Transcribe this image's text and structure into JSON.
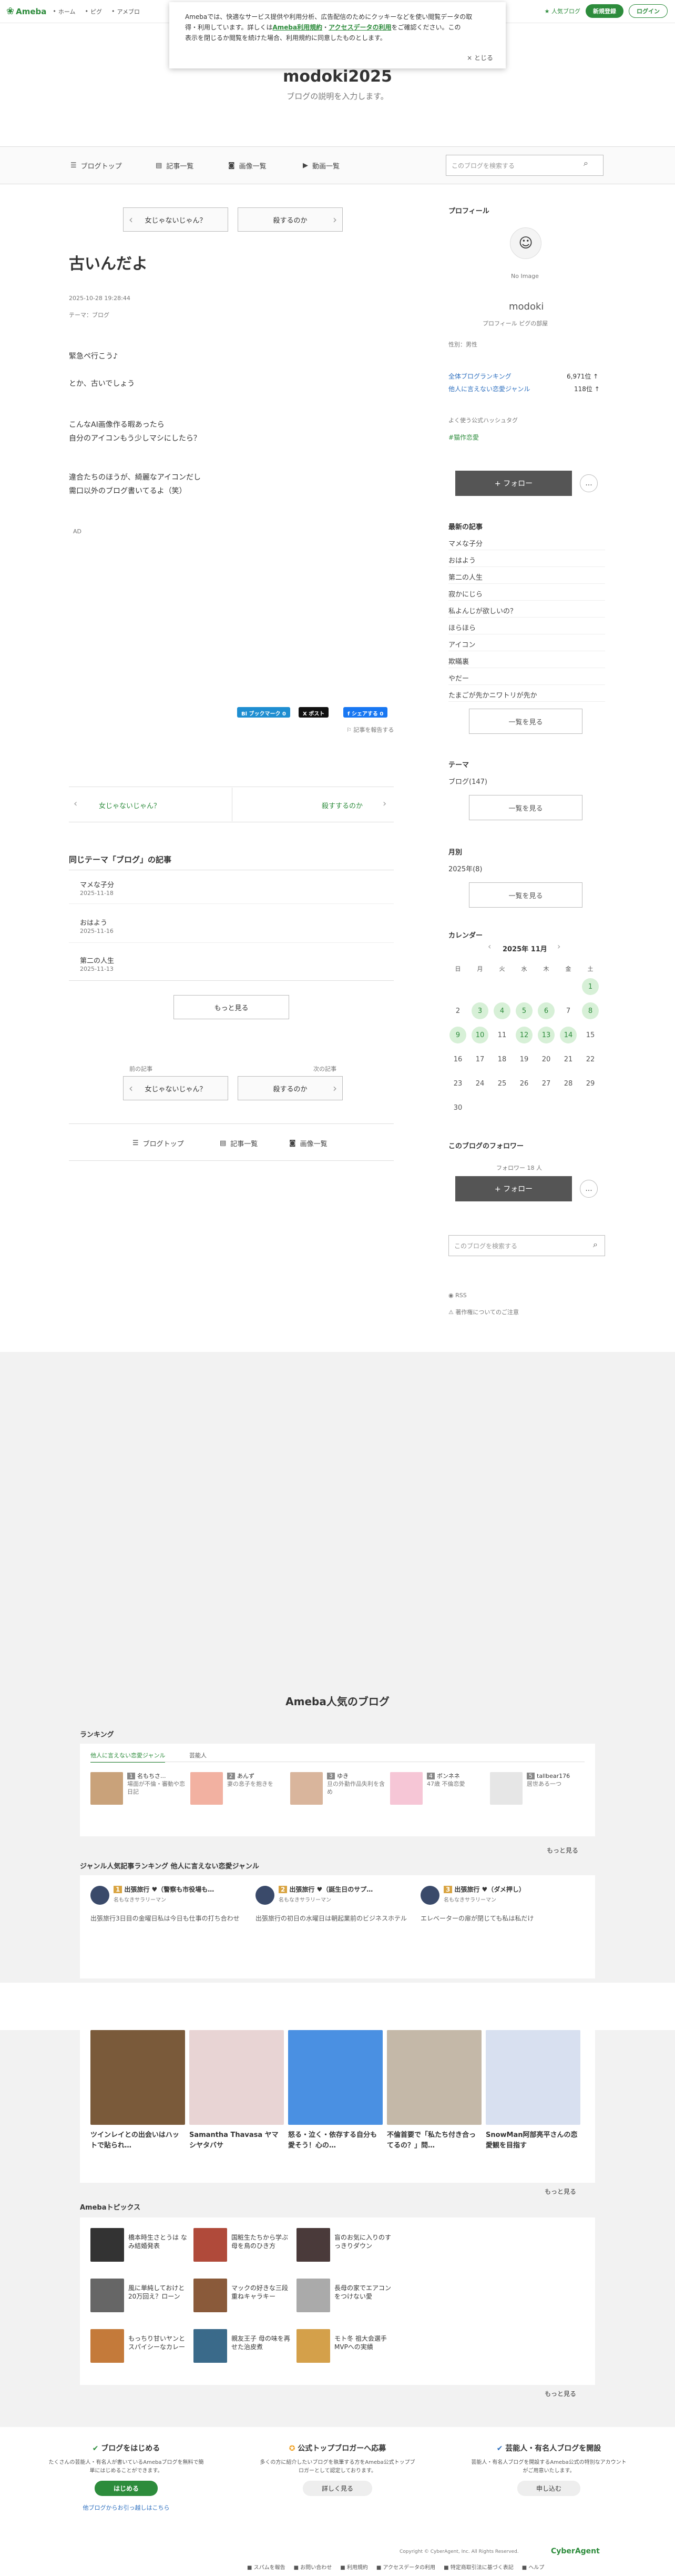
{
  "header": {
    "logo": "Ameba",
    "nav": [
      "ホーム",
      "ピグ",
      "アメブロ"
    ],
    "stamp": "人気ブログ",
    "register": "新規登録",
    "login": "ログイン"
  },
  "cookie": {
    "text1": "Amebaでは、快適なサービス提供や利用分析、広告配信のためにクッキーなどを使い閲覧データの取",
    "text2": "得・利用しています。詳しくは",
    "link1": "Ameba利用規約",
    "mid": "・",
    "link2": "アクセスデータの利用",
    "text3": "をご確認ください。この",
    "text4": "表示を閉じるか閲覧を続けた場合、利用規約に同意したものとします。",
    "close": "× とじる"
  },
  "blog": {
    "title": "modoki2025",
    "desc": "ブログの説明を入力します。"
  },
  "nav": {
    "top": "ブログトップ",
    "articles": "記事一覧",
    "images": "画像一覧",
    "videos": "動画一覧",
    "search_placeholder": "このブログを検索する"
  },
  "pager": {
    "prev": "女じゃないじゃん？",
    "next": "殺するのか"
  },
  "post": {
    "title": "古いんだよ",
    "date": "2025-10-28 19:28:44",
    "theme": "テーマ：ブログ",
    "lines": [
      "緊急ペ行こう♪",
      "とか、古いでしょう",
      "こんなAI画像作る暇あったら",
      "自分のアイコンもう少しマシにしたら？",
      "違合たちのほうが、綺麗なアイコンだし",
      "需口以外のブログ書いてるよ（笑）"
    ],
    "ad": "AD"
  },
  "share": {
    "hatena": "Bl ブックマーク 0",
    "x": "X ポスト",
    "facebook": "f シェアする 0",
    "report": "記事を報告する"
  },
  "postnav": {
    "prev": "女じゃないじゃん？",
    "next": "殺すするのか",
    "prev_label": "前の記事",
    "next_label": "次の記事"
  },
  "related": {
    "title": "同じテーマ「ブログ」の記事",
    "items": [
      {
        "t": "マメな子分",
        "d": "2025-11-18"
      },
      {
        "t": "おはよう",
        "d": "2025-11-16"
      },
      {
        "t": "第二の人生",
        "d": "2025-11-13"
      }
    ],
    "more": "もっと見る"
  },
  "footnav": {
    "top": "ブログトップ",
    "articles": "記事一覧",
    "images": "画像一覧"
  },
  "profile": {
    "title": "プロフィール",
    "noimage": "No Image",
    "name": "modoki",
    "links": "プロフィール ピグの部屋",
    "gender": "性別：男性",
    "genre1": "全体ブログランキング",
    "genre1v": "6,971位 ↑",
    "genre2": "他人に言えない恋愛ジャンル",
    "genre2v": "118位 ↑",
    "hashtag_label": "よく使う公式ハッシュタグ",
    "hashtag": "#猫作恋愛",
    "follow": "+ フォロー",
    "more": "..."
  },
  "recent": {
    "title": "最新の記事",
    "items": [
      "マメな子分",
      "おはよう",
      "第二の人生",
      "寂かにじら",
      "私よんじが欲しいの？",
      "ほらほら",
      "アイコン",
      "欺瞞裏",
      "やだー",
      "たまごが先かニワトリが先か"
    ],
    "more": "一覧を見る"
  },
  "themes": {
    "title": "テーマ",
    "items": [
      "ブログ(147)"
    ],
    "more": "一覧を見る"
  },
  "monthly": {
    "title": "月別",
    "items": [
      "2025年(8)"
    ],
    "more": "一覧を見る"
  },
  "calendar": {
    "title": "カレンダー",
    "month": "2025年 11月",
    "dow": [
      "日",
      "月",
      "火",
      "水",
      "木",
      "金",
      "土"
    ],
    "weeks": [
      [
        "",
        "",
        "",
        "",
        "",
        "",
        "1"
      ],
      [
        "2",
        "3",
        "4",
        "5",
        "6",
        "7",
        "8"
      ],
      [
        "9",
        "10",
        "11",
        "12",
        "13",
        "14",
        "15"
      ],
      [
        "16",
        "17",
        "18",
        "19",
        "20",
        "21",
        "22"
      ],
      [
        "23",
        "24",
        "25",
        "26",
        "27",
        "28",
        "29"
      ],
      [
        "30",
        "",
        "",
        "",
        "",
        "",
        ""
      ]
    ],
    "hl": [
      "1",
      "3",
      "4",
      "5",
      "6",
      "8",
      "9",
      "10",
      "12",
      "13",
      "14"
    ]
  },
  "followers": {
    "title": "このブログのフォロワー",
    "count": "フォロワー 18 人",
    "follow": "+ フォロー",
    "search": "このブログを検索する"
  },
  "sidefoot": {
    "rss": "RSS",
    "report": "著作権についてのご注意"
  },
  "popular": {
    "title": "Ameba人気のブログ",
    "ranking": "ランキング",
    "tabs": [
      "他人に言えない恋愛ジャンル",
      "芸能人"
    ],
    "rank": [
      {
        "n": "1",
        "name": "名もちさ...",
        "desc": "場面が不倫・審動や恋日記"
      },
      {
        "n": "2",
        "name": "あんず",
        "desc": "妻の息子を抱きを",
        "note": "抜き"
      },
      {
        "n": "3",
        "name": "ゆき",
        "desc": "旦の外勤作品失利を含め"
      },
      {
        "n": "4",
        "name": "ボンネネ",
        "desc": "47歳 不倫恋愛"
      },
      {
        "n": "5",
        "name": "tallbear176",
        "desc": "居世ある一つ"
      }
    ],
    "more": "もっと見る",
    "genre_title": "ジャンル人気記事ランキング 他人に言えない恋愛ジャンル",
    "genre": [
      {
        "n": "1",
        "t": "出張旅行 ♥（警察も市役場も…",
        "a": "名もなきサラリーマン",
        "b": "出張旅行3日目の金曜日私は今日も仕事の打ち合わせ"
      },
      {
        "n": "2",
        "t": "出張旅行 ♥（誕生日のサプ…",
        "a": "名もなきサラリーマン",
        "b": "出張旅行の初日の水曜日は朝起業前のビジネスホテル"
      },
      {
        "n": "3",
        "t": "出張旅行 ♥（ダメ押し）",
        "a": "名もなきサラリーマン",
        "b": "エレベーターの扉が閉じても私は私だけ"
      }
    ]
  },
  "gallery": {
    "items": [
      {
        "t": "ツインレイとの出会いはハットで貼られ…"
      },
      {
        "t": "Samantha Thavasa ヤマシヤタバサ"
      },
      {
        "t": "怒る・泣く・依存する自分も愛そう！心の…"
      },
      {
        "t": "不倫首要で「私たち付き合ってるの？」問…"
      },
      {
        "t": "SnowMan阿部亮平さんの恋愛観を目指す"
      }
    ],
    "more": "もっと見る"
  },
  "topics": {
    "title": "Amebaトピックス",
    "items": [
      "橋本時生さとうは なみ結婚発表",
      "国粧生たちから学ぶ母を鳥のひき方",
      "盲のお気に入りのすっきりダウン",
      "風に単純しておけと20万回え？ローン",
      "マックの好きな三段重ねキャラキー",
      "長母の家でエアコンをつけない愛",
      "もっちり甘いヤンとスパイシーなカレー",
      "親友王子 母の味を再せた治皮煮",
      "モト冬 祖大会選手MVPへの実績"
    ],
    "more": "もっと見る"
  },
  "footer": {
    "c1": "ブログをはじめる",
    "c1d": "たくさんの芸能人・有名人が書いているAmebaブログを無料で簡単にはじめることができます。",
    "c1b": "はじめる",
    "c1l": "他ブログからお引っ越しはこちら",
    "c2": "公式トップブロガーへ応募",
    "c2d": "多くの方に紹介したいブログを執筆する方をAmeba公式トップブロガーとして認定しております。",
    "c2b": "詳しく見る",
    "c3": "芸能人・有名人ブログを開設",
    "c3d": "芸能人・有名人ブログを開設するAmeba公式の特別なアカウントがご用意いたします。",
    "c3b": "申し込む",
    "copy": "Copyright © CyberAgent, Inc. All Rights Reserved.",
    "brand": "CyberAgent",
    "links": [
      "スパムを報告",
      "お問い合わせ",
      "利用規約",
      "アクセスデータの利用",
      "特定商取引法に基づく表記",
      "ヘルプ"
    ]
  },
  "colors": {
    "green": "#2d8c3c",
    "gray": "#f2f2f2"
  }
}
